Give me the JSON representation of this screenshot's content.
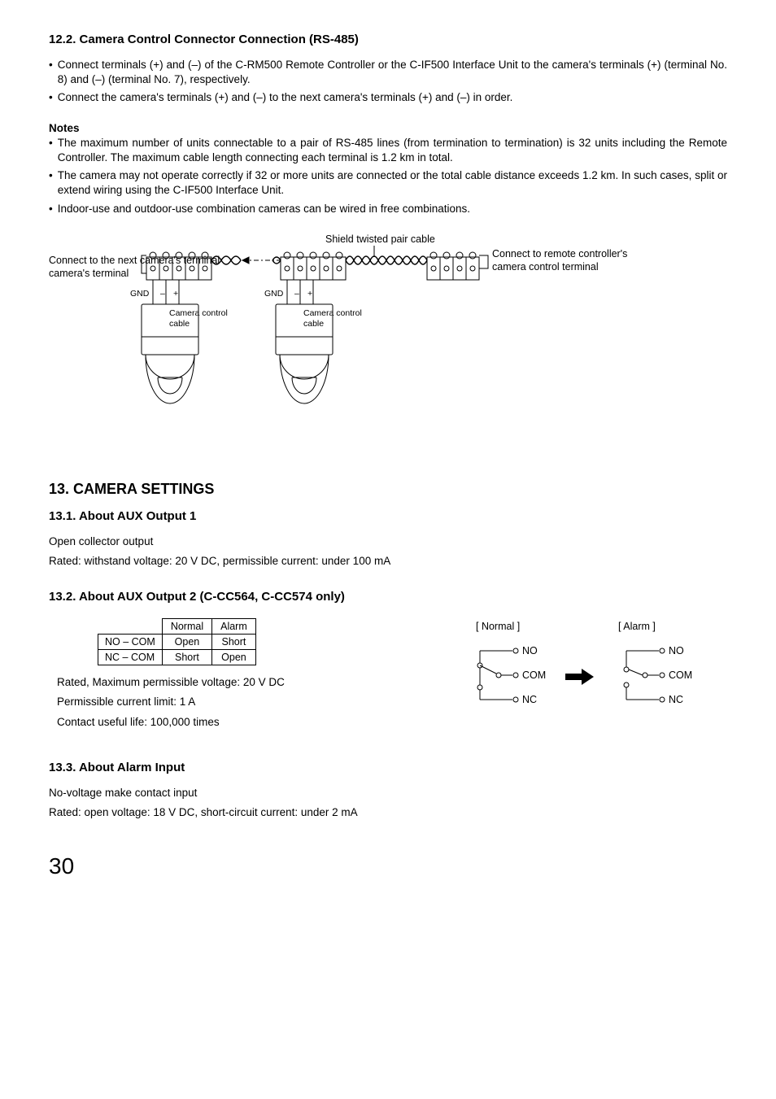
{
  "section12_2": {
    "heading": "12.2. Camera Control Connector Connection (RS-485)",
    "bullets": [
      "Connect terminals (+) and (–) of the C-RM500 Remote Controller or the C-IF500 Interface Unit to the camera's terminals (+) (terminal No. 8) and (–) (terminal No. 7), respectively.",
      "Connect the camera's terminals (+) and (–) to the next camera's terminals (+) and (–) in order."
    ],
    "notes_heading": "Notes",
    "notes": [
      "The maximum number of units connectable to a pair of RS-485 lines (from termination to termination) is 32 units including the Remote Controller. The maximum cable length connecting each terminal is 1.2 km in total.",
      "The camera may not operate correctly if 32 or more units are connected or the total cable distance exceeds 1.2 km. In such cases, split or extend wiring using the C-IF500 Interface Unit.",
      "Indoor-use and outdoor-use combination cameras can be wired in free combinations."
    ],
    "diagram": {
      "label_shield": "Shield twisted pair cable",
      "label_left": "Connect to the next camera's terminal",
      "label_right1": "Connect to remote controller's",
      "label_right2": "camera control terminal",
      "gnd": "GND",
      "minus": "–",
      "plus": "+",
      "cc1": "Camera control",
      "cc2": "cable"
    }
  },
  "section13": {
    "heading": "13. CAMERA SETTINGS"
  },
  "section13_1": {
    "heading": "13.1. About AUX Output 1",
    "line1": "Open collector output",
    "line2": "Rated: withstand voltage: 20 V DC, permissible current: under 100 mA"
  },
  "section13_2": {
    "heading": "13.2. About AUX Output 2 (C-CC564, C-CC574 only)",
    "table": {
      "col_normal": "Normal",
      "col_alarm": "Alarm",
      "row_no": "NO – COM",
      "row_nc": "NC – COM",
      "v_open": "Open",
      "v_short": "Short"
    },
    "specs": [
      "Rated, Maximum permissible voltage: 20 V DC",
      "Permissible current limit: 1 A",
      "Contact useful life: 100,000 times"
    ],
    "relay": {
      "normal_title": "[ Normal ]",
      "alarm_title": "[ Alarm ]",
      "no": "NO",
      "com": "COM",
      "nc": "NC"
    }
  },
  "section13_3": {
    "heading": "13.3. About Alarm Input",
    "line1": "No-voltage make contact input",
    "line2": "Rated: open voltage: 18 V DC, short-circuit current: under 2 mA"
  },
  "page_number": "30"
}
